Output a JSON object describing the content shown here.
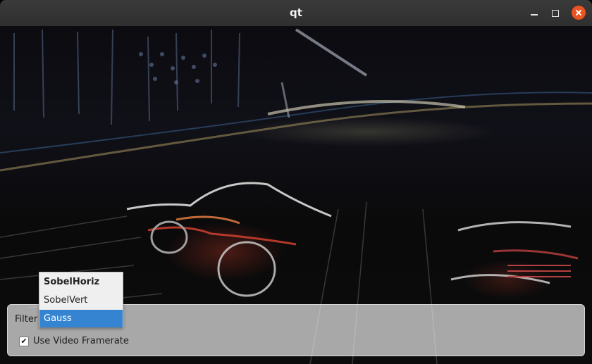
{
  "window": {
    "title": "qt"
  },
  "controls": {
    "filter_label": "Filter",
    "filter_options": [
      "SobelHoriz",
      "SobelVert",
      "Gauss"
    ],
    "filter_selected": "Gauss",
    "use_framerate_label": "Use Video Framerate",
    "use_framerate_checked": true,
    "check_glyph": "✔"
  },
  "colors": {
    "titlebar": "#2f2f2f",
    "close_button": "#e95420",
    "selection": "#3584d2"
  }
}
